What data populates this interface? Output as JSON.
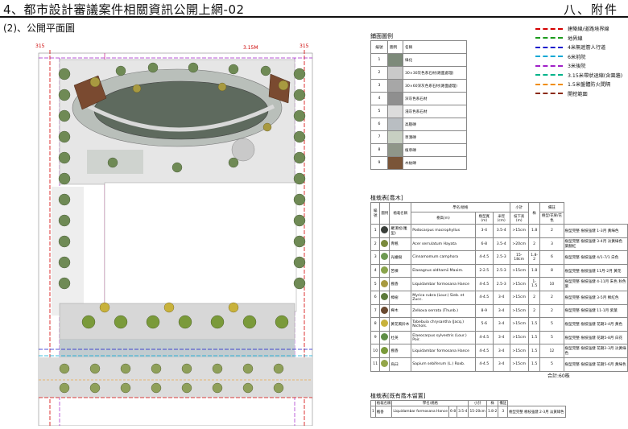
{
  "header": {
    "title": "4、都市設計審議案件相關資訊公開上網-02",
    "appendix": "八、附件"
  },
  "subtitle": "(2)、公開平面圖",
  "plan": {
    "dim_left": "315",
    "dim_mid": "3.15M",
    "dim_right": "315"
  },
  "line_legend": [
    {
      "label": "建築線/道路境界線",
      "color": "#d40000",
      "style": "dashed"
    },
    {
      "label": "地界線",
      "color": "#1a9a1a",
      "style": "dashed"
    },
    {
      "label": "4米無遮簷人行道",
      "color": "#1a1acc",
      "style": "dashed"
    },
    {
      "label": "6米前院",
      "color": "#00a6d4",
      "style": "dashed"
    },
    {
      "label": "3米後院",
      "color": "#a020c8",
      "style": "dashed"
    },
    {
      "label": "3.15米帶狀退縮(含圍牆)",
      "color": "#00b38a",
      "style": "dashed"
    },
    {
      "label": "1.5米盤體防火間隔",
      "color": "#f08c00",
      "style": "dashed"
    },
    {
      "label": "開挖範圍",
      "color": "#8b2a10",
      "style": "dashed"
    }
  ],
  "paving_legend": {
    "title": "鋪面圖例",
    "col_index": "編號",
    "col_swatch": "圖例",
    "col_name": "名稱",
    "rows": [
      {
        "idx": "1",
        "name": "綠化",
        "color": "#7d8a7a"
      },
      {
        "idx": "2",
        "name": "30×30灰色系石材(路面處理)",
        "color": "#c9c9c9"
      },
      {
        "idx": "3",
        "name": "30×60深灰色系石材(路面處理)",
        "color": "#a7a7a7"
      },
      {
        "idx": "4",
        "name": "深灰色系石材",
        "color": "#8f8f8f"
      },
      {
        "idx": "5",
        "name": "淺灰色系石材",
        "color": "#dcdcdc"
      },
      {
        "idx": "6",
        "name": "高壓磚",
        "color": "#b9bec2"
      },
      {
        "idx": "7",
        "name": "草溝磚",
        "color": "#c7cfc2"
      },
      {
        "idx": "8",
        "name": "植草磚",
        "color": "#8f9689"
      },
      {
        "idx": "9",
        "name": "木紋磚",
        "color": "#7a5538"
      }
    ]
  },
  "tree_table": {
    "title": "植栽表[喬木]",
    "headers": {
      "no": "編號",
      "icon": "圖例",
      "name": "植栽名稱",
      "spec": "學名/規格",
      "spec_h": "樹高(m)",
      "spec_w": "樹型寬(m)",
      "spec_d": "米徑(cm)",
      "qty": "小計",
      "qty_sub": "枝下高(m)",
      "count": "株",
      "note": "備註",
      "note_sub": "樹型/花果/花色"
    },
    "rows": [
      {
        "no": "1",
        "name": "羅漢松(雕型)",
        "latin": "Podocarpus macrophyllus",
        "h": "3-4",
        "w": "3.5-4",
        "d": ">15cm",
        "branch": "1.8",
        "count": "2",
        "note": "樹型完整 樹枝強健 1-3月 黃綠色",
        "icon": "#3a3f3a"
      },
      {
        "no": "2",
        "name": "青楓",
        "latin": "Acer serrulatum Hayata",
        "h": "6-8",
        "w": "3.5-4",
        "d": ">20cm",
        "branch": "2",
        "count": "3",
        "note": "樹型完整 樹枝強健 3-4月 淡黃綠色 葉翻紅",
        "icon": "#7a8a3c"
      },
      {
        "no": "3",
        "name": "光蠟樹",
        "latin": "Cinnamomum camphora",
        "h": "4-4.5",
        "w": "2.5-3",
        "d": "15-18cm",
        "branch": "1.8-2",
        "count": "6",
        "note": "樹型完整 樹枝強健 4/1-7/1 白色",
        "icon": "#6d9a52"
      },
      {
        "no": "4",
        "name": "苦楝",
        "latin": "Elaeagnus oldhamii Maxim.",
        "h": "2-2.5",
        "w": "2.5-3",
        "d": ">15cm",
        "branch": "1.8",
        "count": "8",
        "note": "樹型完整 樹枝強健 11月-2月 黃花",
        "icon": "#8aa44c"
      },
      {
        "no": "5",
        "name": "楓香",
        "latin": "Liquidambar formosana Hance",
        "h": "4-4.5",
        "w": "2.5-3",
        "d": ">15cm",
        "branch": "1-1.5",
        "count": "10",
        "note": "樹型完整 樹枝強健 4-11月 朱色 秋色葉",
        "icon": "#a89a40"
      },
      {
        "no": "6",
        "name": "樟樹",
        "latin": "Myrica rubra (Lour.) Sieb. et Zucc.",
        "h": "4-4.5",
        "w": "3-4",
        "d": ">15cm",
        "branch": "2",
        "count": "2",
        "note": "樹型完整 樹枝強健 3-5月 鮮紅色",
        "icon": "#5c7a3a"
      },
      {
        "no": "7",
        "name": "櫸木",
        "latin": "Zelkova serrata (Thunb.)",
        "h": "8-9",
        "w": "3-4",
        "d": ">15cm",
        "branch": "2",
        "count": "2",
        "note": "樹型完整 樹枝強健 11-1月 紫葉",
        "icon": "#6a4a30"
      },
      {
        "no": "8",
        "name": "黃花風鈴木",
        "latin": "Tabebuia chrysantha (Jacq.) Nichols.",
        "h": "5-6",
        "w": "3-4",
        "d": ">15cm",
        "branch": "1.5",
        "count": "5",
        "note": "樹型完整 樹枝強健 花期3-4月 黃色",
        "icon": "#c8b23c"
      },
      {
        "no": "9",
        "name": "杜英",
        "latin": "Elaeocarpus sylvestris (Lour.) Poir.",
        "h": "4-4.5",
        "w": "3-4",
        "d": ">15cm",
        "branch": "1.5",
        "count": "5",
        "note": "樹型完整 樹枝強健 花期5-8月 白花",
        "icon": "#5f8e46"
      },
      {
        "no": "10",
        "name": "楓香",
        "latin": "Liquidambar formosana Hance",
        "h": "4-4.5",
        "w": "3-4",
        "d": ">15cm",
        "branch": "1.5",
        "count": "12",
        "note": "樹型完整 樹枝強健 花期2-3月 淡黃綠色",
        "icon": "#7a9a3a"
      },
      {
        "no": "11",
        "name": "烏臼",
        "latin": "Sapium sebiferum (L.) Roxb.",
        "h": "4-4.5",
        "w": "3-4",
        "d": ">15cm",
        "branch": "1.5",
        "count": "5",
        "note": "樹型完整 樹枝強健 花期5-6月 黃綠色",
        "icon": "#94a64a"
      }
    ],
    "total": "合計:60株"
  },
  "shrub_table": {
    "title": "植栽表[既有喬木留置]",
    "headers": {
      "name": "植栽名稱",
      "spec": "學名/規格",
      "spec_h": "樹高(m)",
      "spec_w": "樹型寬(m)",
      "spec_d": "米徑(cm)",
      "qty": "小計",
      "qty_sub": "枝下高(m)",
      "count": "株",
      "note": "備註",
      "note_sub": "樹型/花果/花色"
    },
    "rows": [
      {
        "no": "1",
        "name": "楓香",
        "latin": "Liquidambar formosana Hance",
        "h": "6-8",
        "w": "3.5-4",
        "d": "15-20cm",
        "branch": "1.8-2",
        "count": "3",
        "note": "樹型完整 樹枝強健 2-3月 淡黃綠色",
        "icon": "#7a9a3a"
      }
    ]
  }
}
